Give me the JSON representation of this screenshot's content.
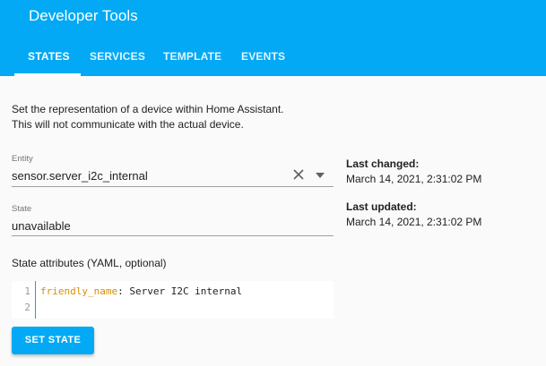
{
  "header": {
    "title": "Developer Tools",
    "tabs": [
      {
        "label": "STATES",
        "active": true
      },
      {
        "label": "SERVICES",
        "active": false
      },
      {
        "label": "TEMPLATE",
        "active": false
      },
      {
        "label": "EVENTS",
        "active": false
      }
    ],
    "accent_color": "#03a9f4"
  },
  "description": {
    "line1": "Set the representation of a device within Home Assistant.",
    "line2": "This will not communicate with the actual device."
  },
  "entity": {
    "label": "Entity",
    "value": "sensor.server_i2c_internal",
    "clear_icon": "close-icon",
    "dropdown_icon": "arrow-drop-down-icon"
  },
  "state": {
    "label": "State",
    "value": "unavailable"
  },
  "info": {
    "last_changed_label": "Last changed:",
    "last_changed_value": "March 14, 2021, 2:31:02 PM",
    "last_updated_label": "Last updated:",
    "last_updated_value": "March 14, 2021, 2:31:02 PM"
  },
  "attributes": {
    "label": "State attributes (YAML, optional)",
    "lines": [
      {
        "number": "1",
        "key": "friendly_name",
        "value": ": Server I2C internal"
      },
      {
        "number": "2",
        "key": "",
        "value": ""
      }
    ]
  },
  "actions": {
    "set_state_label": "SET STATE"
  }
}
